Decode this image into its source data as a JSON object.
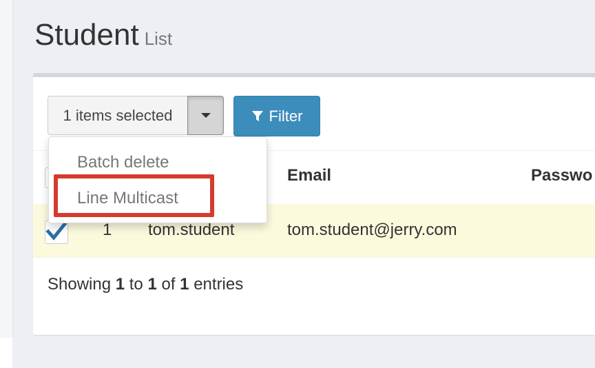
{
  "page": {
    "title": "Student",
    "subtitle": "List"
  },
  "toolbar": {
    "selected_label": "1 items selected",
    "filter_label": "Filter"
  },
  "dropdown": {
    "items": [
      "Batch delete",
      "Line Multicast"
    ]
  },
  "table": {
    "columns": [
      "Email",
      "Passwo"
    ],
    "rows": [
      {
        "id": "1",
        "username": "tom.student",
        "email": "tom.student@jerry.com",
        "checked": true
      }
    ]
  },
  "footer": {
    "prefix": "Showing",
    "from": "1",
    "to_word": "to",
    "to": "1",
    "of_word": "of",
    "total": "1",
    "suffix": "entries"
  },
  "colors": {
    "primary": "#3c8dbc",
    "highlight": "#d63a2e",
    "selected_row": "#fcfadd"
  }
}
